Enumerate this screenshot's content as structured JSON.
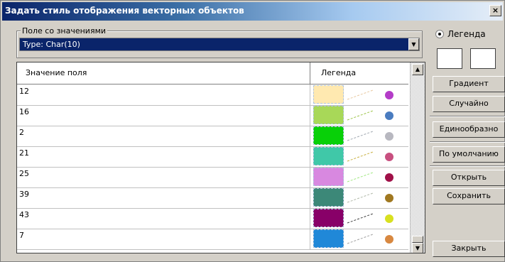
{
  "window": {
    "title": "Задать стиль отображения векторных объектов",
    "close_label": "×"
  },
  "field_group": {
    "label": "Поле со значениями",
    "selected_value": "Type: Char(10)"
  },
  "table": {
    "headers": {
      "value": "Значение поля",
      "legend": "Легенда"
    },
    "rows": [
      {
        "value": "12",
        "fill_color": "#ffe9b0",
        "line_color": "#e8c8a0",
        "dot_color": "#b43cc8"
      },
      {
        "value": "16",
        "fill_color": "#a8d858",
        "line_color": "#9cc448",
        "dot_color": "#4a7cc0"
      },
      {
        "value": "2",
        "fill_color": "#08d008",
        "line_color": "#a0a8b0",
        "dot_color": "#b8b8c0"
      },
      {
        "value": "21",
        "fill_color": "#40c8a8",
        "line_color": "#c8b040",
        "dot_color": "#c85080"
      },
      {
        "value": "25",
        "fill_color": "#d888e0",
        "line_color": "#a0e880",
        "dot_color": "#a01048"
      },
      {
        "value": "39",
        "fill_color": "#3c8878",
        "line_color": "#b0b8a8",
        "dot_color": "#a07820"
      },
      {
        "value": "43",
        "fill_color": "#880068",
        "line_color": "#404040",
        "dot_color": "#d8e020"
      },
      {
        "value": "7",
        "fill_color": "#2088d8",
        "line_color": "#a0a0a0",
        "dot_color": "#d88840"
      }
    ]
  },
  "legend_panel": {
    "radio_label": "Легенда"
  },
  "buttons": {
    "gradient": "Градиент",
    "random": "Случайно",
    "uniform": "Единообразно",
    "default": "По умолчанию",
    "open": "Открыть",
    "save": "Сохранить",
    "close": "Закрыть"
  }
}
